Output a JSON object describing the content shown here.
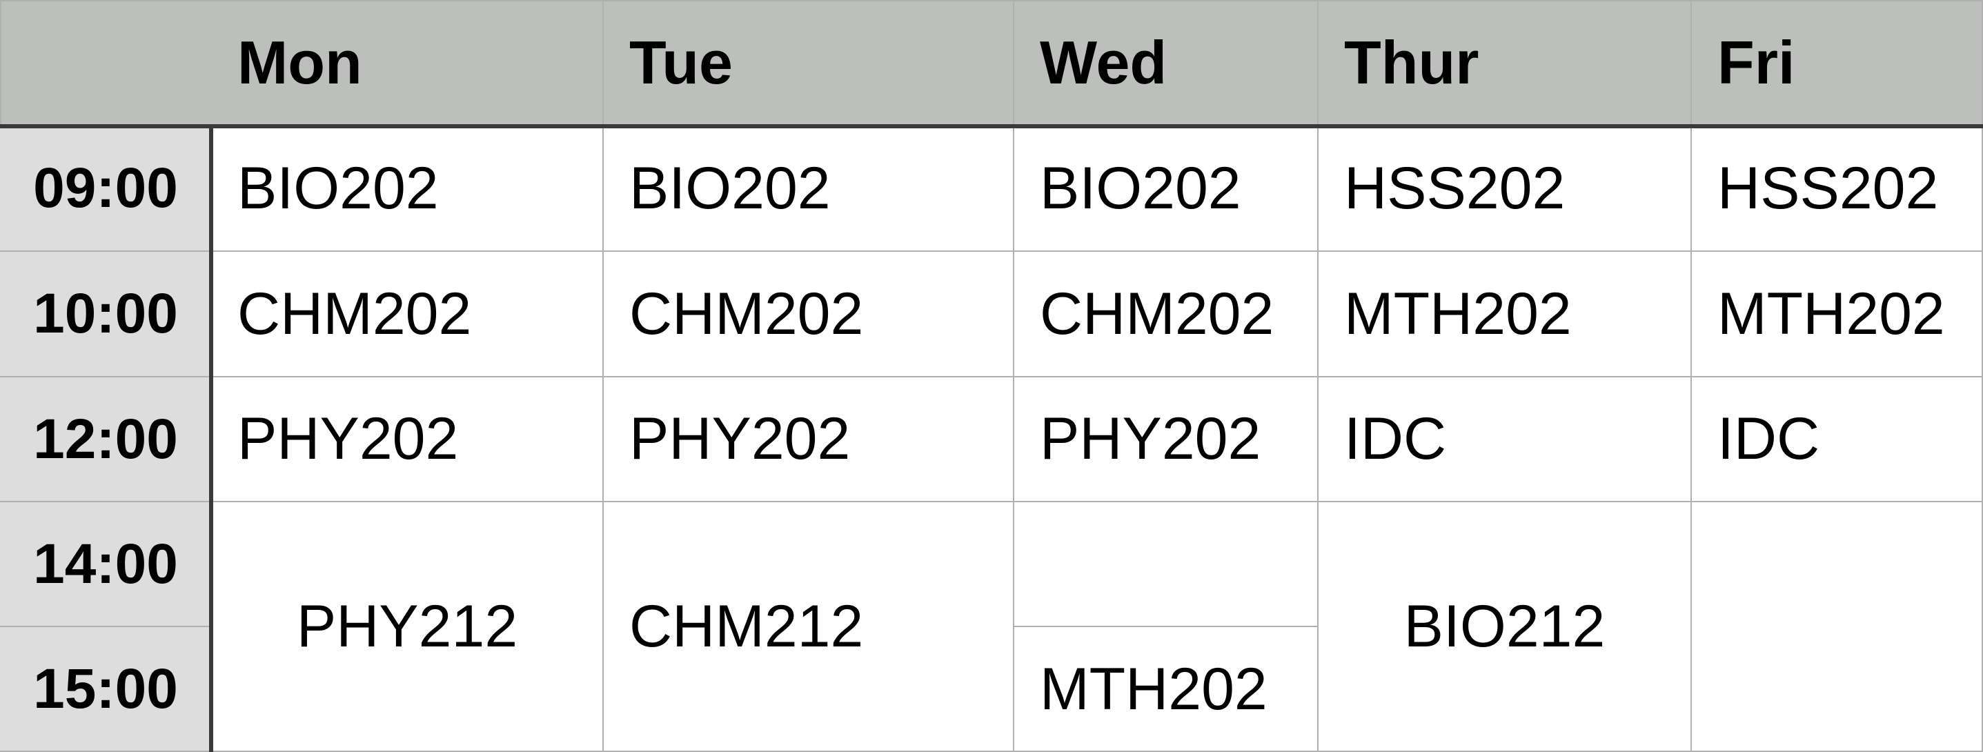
{
  "days": [
    "Mon",
    "Tue",
    "Wed",
    "Thur",
    "Fri"
  ],
  "times": [
    "09:00",
    "10:00",
    "12:00",
    "14:00",
    "15:00"
  ],
  "slots": {
    "mon": [
      "BIO202",
      "CHM202",
      "PHY202",
      "PHY212"
    ],
    "tue": [
      "BIO202",
      "CHM202",
      "PHY202",
      "CHM212"
    ],
    "wed": [
      "BIO202",
      "CHM202",
      "PHY202",
      "",
      "MTH202"
    ],
    "thur": [
      "HSS202",
      "MTH202",
      "IDC",
      "BIO212"
    ],
    "fri": [
      "HSS202",
      "MTH202",
      "IDC",
      ""
    ]
  },
  "colors": {
    "header_bg": "#bdbfbd",
    "time_bg": "#dddddd",
    "cell_bg": "#ffffff",
    "grid_line": "#b0b0b0",
    "header_rule": "#3a3a3a"
  }
}
